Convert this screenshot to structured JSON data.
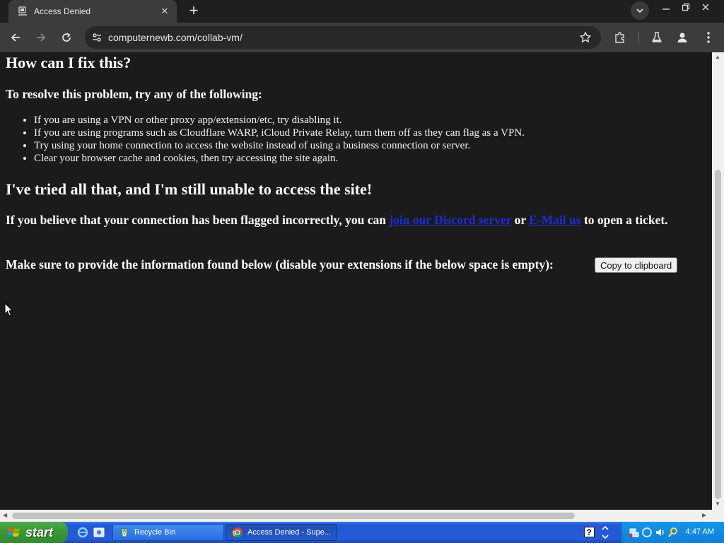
{
  "browser": {
    "tab_title": "Access Denied",
    "url": "computernewb.com/collab-vm/"
  },
  "content": {
    "heading_fix": "How can I fix this?",
    "heading_resolve": "To resolve this problem, try any of the following:",
    "bullets": [
      "If you are using a VPN or other proxy app/extension/etc, try disabling it.",
      "If you are using programs such as Cloudflare WARP, iCloud Private Relay, turn them off as they can flag as a VPN.",
      "Try using your home connection to access the website instead of using a business connection or server.",
      "Clear your browser cache and cookies, then try accessing the site again."
    ],
    "heading_tried": "I've tried all that, and I'm still unable to access the site!",
    "flagged_pre": "If you believe that your connection has been flagged incorrectly, you can",
    "link_discord": "join our Discord server",
    "flagged_mid": "or",
    "link_email": "E-Mail us",
    "flagged_post": "to open a ticket.",
    "info_text": "Make sure to provide the information found below (disable your extensions if the below space is empty):",
    "copy_button": "Copy to clipboard"
  },
  "taskbar": {
    "start_label": "start",
    "tasks": [
      {
        "label": "Recycle Bin"
      },
      {
        "label": "Access Denied - Supe..."
      }
    ],
    "clock": "4:47 AM"
  },
  "colors": {
    "page_bg": "#1b1b1b",
    "link": "#1f2bd6",
    "taskbar_blue": "#235bd9",
    "start_green": "#3c9a38"
  }
}
